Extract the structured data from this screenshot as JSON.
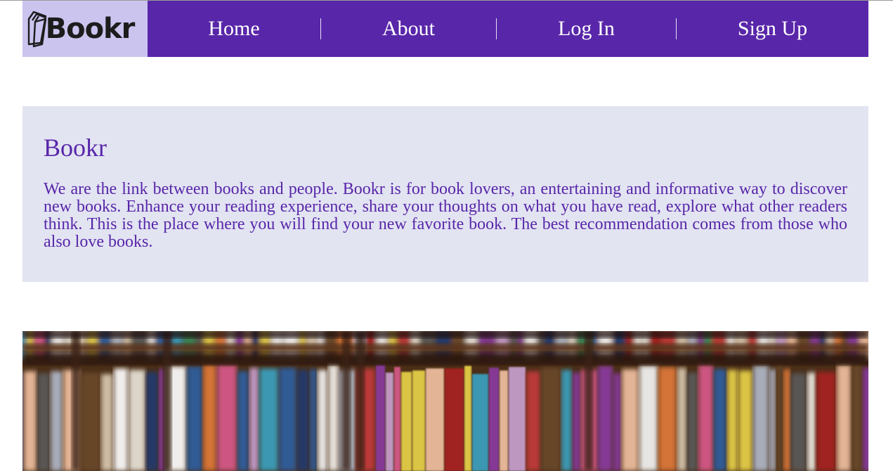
{
  "header": {
    "logo": {
      "icon": "books-stack-icon",
      "text": "Bookr"
    },
    "nav": [
      {
        "label": "Home"
      },
      {
        "label": "About"
      },
      {
        "label": "Log In"
      },
      {
        "label": "Sign Up"
      }
    ],
    "colors": {
      "nav_bg": "#5826a9",
      "logo_bg": "#cac4ef",
      "nav_text": "#ffffff"
    }
  },
  "intro": {
    "title": "Bookr",
    "body": "We are the link between books and people. Bookr is for book lovers, an entertaining and informative way to discover new books. Enhance your reading experience, share your thoughts on what you have read, explore what other readers think. This is the place where you will find your new favorite book. The best recommendation comes from those who also love books.",
    "colors": {
      "bg": "#e2e4f2",
      "text": "#5826a9"
    }
  },
  "hero": {
    "image": "bookshelf-photo"
  }
}
